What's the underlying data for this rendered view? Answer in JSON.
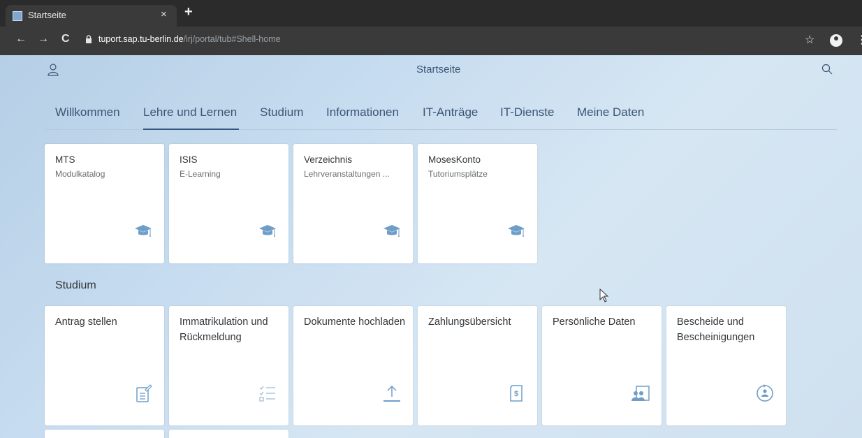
{
  "browser": {
    "tab_title": "Startseite",
    "tab_close": "×",
    "new_tab": "+",
    "back": "←",
    "forward": "→",
    "reload": "C",
    "lock": "🔒",
    "url_domain": "tuport.sap.tu-berlin.de",
    "url_path": "/irj/portal/tub#Shell-home",
    "star": "☆",
    "menu": "⋮"
  },
  "shell": {
    "title": "Startseite"
  },
  "nav_tabs": [
    {
      "label": "Willkommen"
    },
    {
      "label": "Lehre und Lernen"
    },
    {
      "label": "Studium"
    },
    {
      "label": "Informationen"
    },
    {
      "label": "IT-Anträge"
    },
    {
      "label": "IT-Dienste"
    },
    {
      "label": "Meine Daten"
    }
  ],
  "active_tab": "Lehre und Lernen",
  "lehre_tiles": [
    {
      "title": "MTS",
      "subtitle": "Modulkatalog",
      "icon": "graduation-cap-icon"
    },
    {
      "title": "ISIS",
      "subtitle": "E-Learning",
      "icon": "graduation-cap-icon"
    },
    {
      "title": "Verzeichnis",
      "subtitle": "Lehrveranstaltungen ...",
      "icon": "graduation-cap-icon"
    },
    {
      "title": "MosesKonto",
      "subtitle": "Tutoriumsplätze",
      "icon": "graduation-cap-icon"
    }
  ],
  "studium_section": {
    "title": "Studium",
    "tiles": [
      {
        "title": "Antrag stellen",
        "icon": "form-edit-icon"
      },
      {
        "title": "Immatrikulation und Rückmeldung",
        "icon": "checklist-icon"
      },
      {
        "title": "Dokumente hochladen",
        "icon": "upload-icon"
      },
      {
        "title": "Zahlungsübersicht",
        "icon": "payment-document-icon"
      },
      {
        "title": "Persönliche Daten",
        "icon": "employee-data-icon"
      },
      {
        "title": "Bescheide und Bescheinigungen",
        "icon": "user-cycle-icon"
      }
    ]
  },
  "colors": {
    "shell_text": "#3b5575",
    "icon": "#6e9ec8",
    "tile_bg": "#ffffff"
  }
}
